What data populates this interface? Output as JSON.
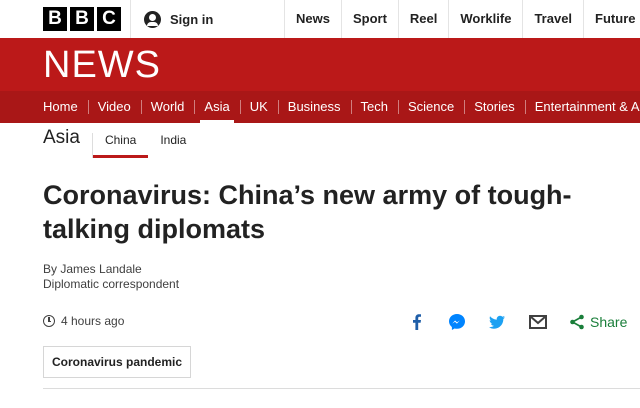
{
  "topbar": {
    "logo_letters": [
      "B",
      "B",
      "C"
    ],
    "signin_label": "Sign in",
    "nav": [
      "News",
      "Sport",
      "Reel",
      "Worklife",
      "Travel",
      "Future"
    ]
  },
  "header": {
    "wordmark": "NEWS",
    "sections": [
      "Home",
      "Video",
      "World",
      "Asia",
      "UK",
      "Business",
      "Tech",
      "Science",
      "Stories",
      "Entertainment & Arts"
    ],
    "active_section": "Asia"
  },
  "subnav": {
    "title": "Asia",
    "items": [
      "China",
      "India"
    ],
    "active_item": "China"
  },
  "article": {
    "headline": "Coronavirus: China’s new army of tough-talking diplomats",
    "author": "By James Landale",
    "role": "Diplomatic correspondent",
    "time": "4 hours ago",
    "tag": "Coronavirus pandemic"
  },
  "share": {
    "label": "Share",
    "icons": [
      "facebook-icon",
      "messenger-icon",
      "twitter-icon",
      "email-icon",
      "share-icon"
    ]
  },
  "colors": {
    "brand_red": "#bb1919",
    "nav_red": "#a91717",
    "facebook": "#1f5ea8",
    "messenger": "#0084ff",
    "twitter": "#1da1f2",
    "email": "#404040",
    "share": "#1a7e3a"
  }
}
